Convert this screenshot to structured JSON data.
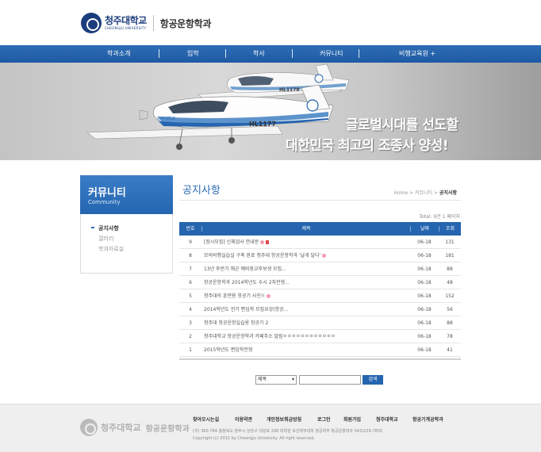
{
  "header": {
    "univ_name": "청주대학교",
    "univ_name_en": "CHEONGJU UNIVERSITY",
    "dept_name": "항공운항학과"
  },
  "nav": {
    "items": [
      "학과소개",
      "입학",
      "학사",
      "커뮤니티",
      "비행교육원 +"
    ]
  },
  "banner": {
    "line1": "글로벌시대를 선도할",
    "line2": "대한민국 최고의 조종사 양성!",
    "plane_front_reg": "HL1177",
    "plane_back_reg": "HL1178",
    "plane_nose_text": "청주대학교"
  },
  "sidebar": {
    "title": "커뮤니티",
    "subtitle": "Community",
    "items": [
      "공지사항",
      "갤러리",
      "학과자료실"
    ]
  },
  "content": {
    "page_title": "공지사항",
    "breadcrumb": {
      "home": "Home",
      "section": "커뮤니티",
      "current": "공지사항",
      "sep": ">"
    },
    "total": "Total: 9건 1 페이지"
  },
  "table": {
    "headers": {
      "no": "번호",
      "title": "제목",
      "date": "날짜",
      "views": "조회"
    },
    "rows": [
      {
        "no": "9",
        "title": "[장시모집] 신체검사 안내문",
        "date": "06-18",
        "views": "131",
        "new": true,
        "file": true
      },
      {
        "no": "8",
        "title": "모의비행실습실 구축 완료 청주대 항공운항학과 '날개 달다'",
        "date": "06-18",
        "views": "181",
        "new": true,
        "file": false
      },
      {
        "no": "7",
        "title": "13년 후반기 해군 예비장교후보생 모집...",
        "date": "06-18",
        "views": "88",
        "new": false,
        "file": false
      },
      {
        "no": "6",
        "title": "항공운항학과 2014학년도 수시 2차전형...",
        "date": "06-18",
        "views": "48",
        "new": false,
        "file": false
      },
      {
        "no": "5",
        "title": "청주대의 훈련용 항공기 사진!!",
        "date": "06-18",
        "views": "152",
        "new": true,
        "file": false
      },
      {
        "no": "4",
        "title": "2014학년도 전기 편입학 모집요강(항공...",
        "date": "06-18",
        "views": "56",
        "new": false,
        "file": false
      },
      {
        "no": "3",
        "title": "청주대 항공운항실습용 항공기 2",
        "date": "06-18",
        "views": "88",
        "new": false,
        "file": false
      },
      {
        "no": "2",
        "title": "청주대학교 항공운항학과 카페주소 알림ㅇㅇㅇㅇㅇㅇㅇㅇㅇㅇㅇㅇ",
        "date": "06-18",
        "views": "78",
        "new": false,
        "file": false
      },
      {
        "no": "1",
        "title": "2015학년도 편입학전형",
        "date": "06-18",
        "views": "41",
        "new": false,
        "file": false
      }
    ]
  },
  "search": {
    "field": "제목",
    "button": "검색"
  },
  "footer": {
    "univ_name": "청주대학교",
    "dept_name": "항공운항학과",
    "links": [
      "찾아오시는길",
      "이용약관",
      "개인정보취급방침",
      "로그인",
      "회원가입",
      "청주대학교",
      "항공기계공학과"
    ],
    "address": "(우) 360-764 충청북도 청주시 상당구 대성로 298 대학원 보건학부대학 항공학부 항공운항학과 043)229-7855",
    "copyright": "Copyright (c) 2012 by Cheongju University. All right reserved."
  },
  "colors": {
    "primary": "#2565b0",
    "nav_blue": "#1e5aa3",
    "title_blue": "#2a6ab3"
  }
}
